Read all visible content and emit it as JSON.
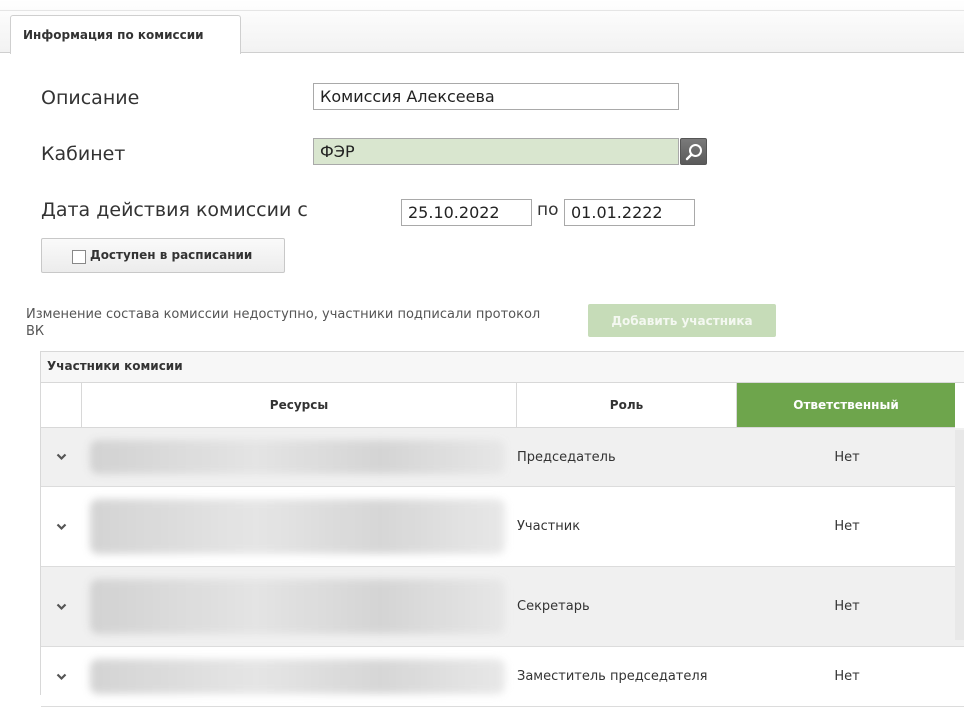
{
  "tab": {
    "label": "Информация по комиссии"
  },
  "form": {
    "description": {
      "label": "Описание",
      "value": "Комиссия Алексеева"
    },
    "cabinet": {
      "label": "Кабинет",
      "value": "ФЭР"
    },
    "validity": {
      "label": "Дата действия комиссии с",
      "from": "25.10.2022",
      "to_label": "по",
      "to": "01.01.2222"
    },
    "schedule_checkbox": {
      "label": "Доступен в расписании",
      "checked": false
    }
  },
  "notice": "Изменение состава комиссии недоступно, участники подписали протокол ВК",
  "add_participant_button": "Добавить участника",
  "grid": {
    "title": "Участники комисии",
    "columns": {
      "resources": "Ресурсы",
      "role": "Роль",
      "responsible": "Ответственный"
    },
    "rows": [
      {
        "role": "Председатель",
        "responsible": "Нет"
      },
      {
        "role": "Участник",
        "responsible": "Нет"
      },
      {
        "role": "Секретарь",
        "responsible": "Нет"
      },
      {
        "role": "Заместитель председателя",
        "responsible": "Нет"
      }
    ]
  },
  "colors": {
    "accent": "#6ea54c",
    "readonly_field": "#d9e6cf",
    "disabled_button": "#c6dcb8"
  },
  "icons": {
    "lookup": "search-icon",
    "expand": "chevron-down-icon"
  }
}
